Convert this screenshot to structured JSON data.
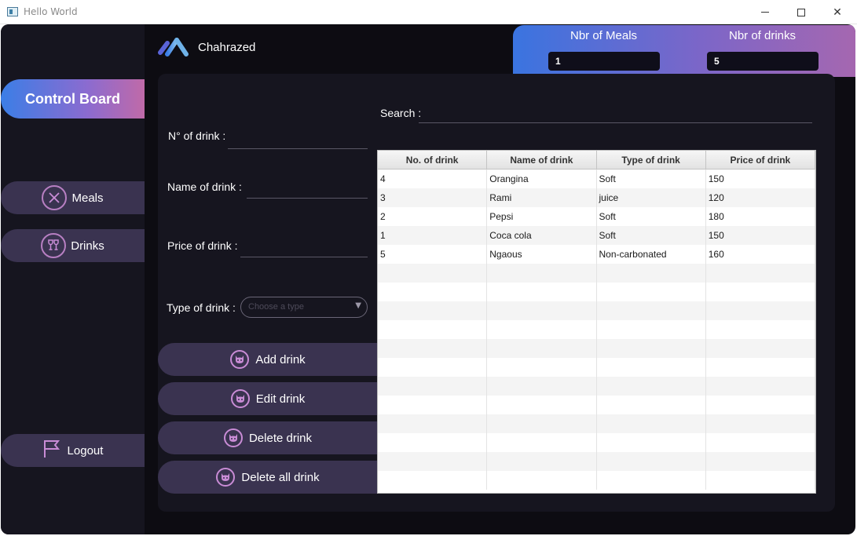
{
  "window": {
    "title": "Hello World"
  },
  "brand": {
    "name": "Chahrazed"
  },
  "sidebar": {
    "control_board": "Control Board",
    "meals": "Meals",
    "drinks": "Drinks",
    "logout": "Logout"
  },
  "stats": {
    "meals_label": "Nbr of Meals",
    "meals_value": "1",
    "drinks_label": "Nbr of drinks",
    "drinks_value": "5"
  },
  "form": {
    "num_label": "N° of drink :",
    "name_label": "Name of drink :",
    "price_label": "Price of drink :",
    "type_label": "Type of drink :",
    "type_placeholder": "Choose a type"
  },
  "actions": {
    "add": "Add drink",
    "edit": "Edit drink",
    "delete": "Delete drink",
    "delete_all": "Delete all drink"
  },
  "search": {
    "label": "Search :",
    "value": ""
  },
  "table": {
    "headers": [
      "No. of drink",
      "Name of drink",
      "Type of drink",
      "Price of drink"
    ],
    "rows": [
      [
        "4",
        "Orangina",
        "Soft",
        "150"
      ],
      [
        "3",
        "Rami",
        "juice",
        "120"
      ],
      [
        "2",
        "Pepsi",
        "Soft",
        "180"
      ],
      [
        "1",
        "Coca cola",
        "Soft",
        "150"
      ],
      [
        "5",
        "Ngaous",
        "Non-carbonated",
        "160"
      ]
    ],
    "empty_rows": 12
  },
  "colors": {
    "accent_gradient_start": "#3b7ee6",
    "accent_gradient_end": "#c06aa8",
    "icon_pink": "#c98cd6",
    "button_bg": "#3a3350"
  }
}
